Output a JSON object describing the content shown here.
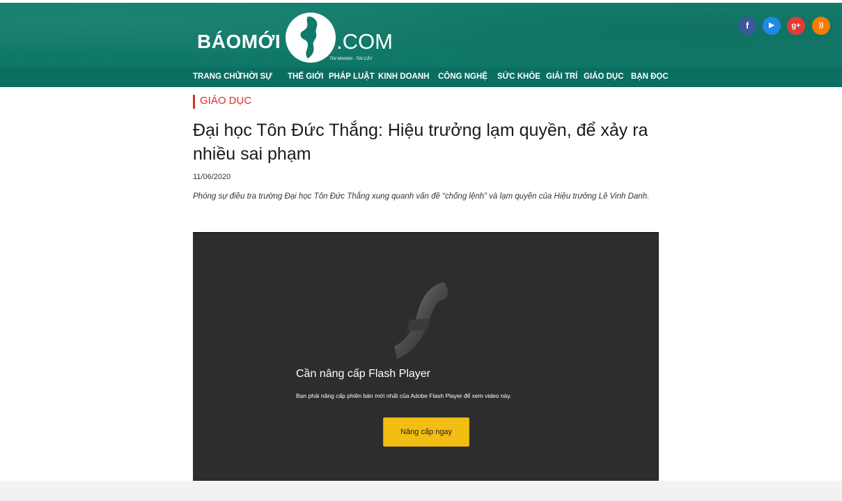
{
  "header": {
    "logo_left": "BÁOMỚI",
    "logo_right": ".COM",
    "logo_slogan": "TIN NHANH - TIN CẬY",
    "nav": [
      "TRANG CHỦ",
      "THỜI SỰ",
      "THẾ GIỚI",
      "PHÁP LUẬT",
      "KINH DOANH",
      "CÔNG NGHỆ",
      "SỨC KHỎE",
      "GIẢI TRÍ",
      "GIÁO DỤC",
      "BẠN ĐỌC"
    ],
    "social": [
      {
        "name": "facebook-icon",
        "glyph": "f",
        "color": "#3b5998"
      },
      {
        "name": "youtube-icon",
        "glyph": "▶",
        "color": "#1e88e5"
      },
      {
        "name": "google-plus-icon",
        "glyph": "g+",
        "color": "#e53935"
      },
      {
        "name": "rss-icon",
        "glyph": "))",
        "color": "#f57c00"
      }
    ],
    "colors": {
      "header_bg": "#0f7a6a",
      "nav_bg": "#0c6d61"
    }
  },
  "article": {
    "category": "GIÁO DỤC",
    "title": "Đại học Tôn Đức Thắng: Hiệu trưởng lạm quyền, để xảy ra nhiều sai phạm",
    "date": "11/06/2020",
    "summary": "Phóng sự điều tra trường Đại học Tôn Đức Thắng xung quanh vấn đề “chống lệnh” và lạm quyền của Hiệu trưởng Lê Vinh Danh.",
    "accent_color": "#e02a20"
  },
  "video": {
    "upgrade_title": "Cần nâng cấp Flash Player",
    "upgrade_desc": "Bạn phải nâng cấp phiên bản mới nhất của Adobe Flash Player để xem video này.",
    "upgrade_button": "Nâng cấp ngay",
    "button_color": "#f3be13"
  }
}
